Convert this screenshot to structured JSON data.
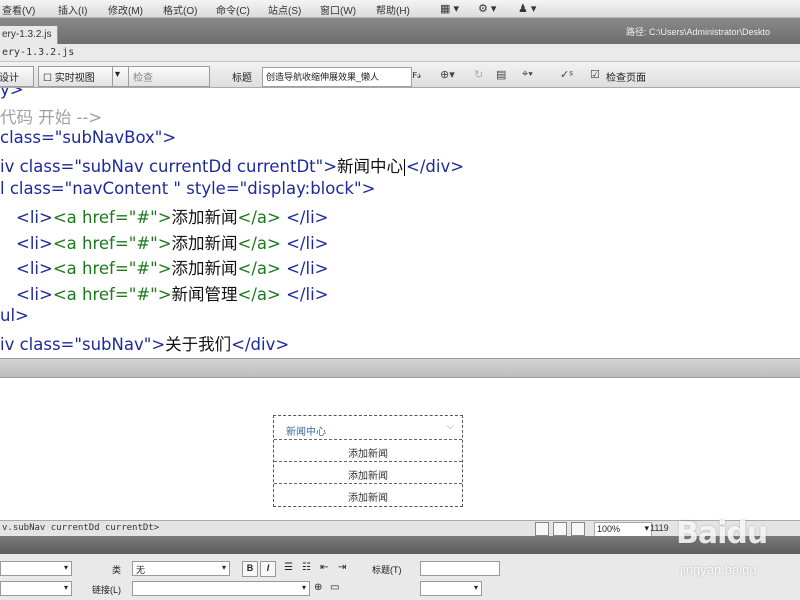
{
  "menu": {
    "items": [
      "查看(V)",
      "插入(I)",
      "修改(M)",
      "格式(O)",
      "命令(C)",
      "站点(S)",
      "窗口(W)",
      "帮助(H)"
    ]
  },
  "titlebar": {
    "tab_label": "ery-1.3.2.js",
    "path_label": "路径: C:\\Users\\Administrator\\Deskto"
  },
  "filebar": {
    "filename": "ery-1.3.2.js"
  },
  "toolbar": {
    "design_label": "设计",
    "live_view_label": "实时视图",
    "inspect_label": "检查",
    "title_label": "标题",
    "title_value": "创造导航收缩伸展效果_懒人",
    "check_page_label": "检查页面"
  },
  "code": {
    "line1": "y>",
    "line2": "代码 开始 -->",
    "line3_attr": "class=",
    "line3_val": "\"subNavBox\"",
    "line3_end": ">",
    "line4_start": "iv class=",
    "line4_val": "\"subNav currentDd currentDt\"",
    "line4_gt": ">",
    "line4_text": "新闻中心",
    "line4_end": "</div>",
    "line5_start": "l class=",
    "line5_val": "\"navContent \"",
    "line5_style": " style=",
    "line5_style_val": "\"display:block\"",
    "line5_end": ">",
    "li_open": "<li>",
    "a_open": "<a href=",
    "a_href": "\"#\"",
    "a_gt": ">",
    "a_close": "</a>",
    "li_close": " </li>",
    "item1": "添加新闻",
    "item2": "添加新闻",
    "item3": "添加新闻",
    "item4": "新闻管理",
    "line10": "ul>",
    "line11_start": "iv class=",
    "line11_val": "\"subNav\"",
    "line11_gt": ">",
    "line11_text": "关于我们",
    "line11_end": "</div>"
  },
  "design": {
    "head_label": "新闻中心",
    "items": [
      "添加新闻",
      "添加新闻",
      "添加新闻"
    ]
  },
  "status": {
    "tag_selector": "v.subNav currentDd currentDt>",
    "zoom": "100%",
    "dims": "1119"
  },
  "properties": {
    "class_label": "类",
    "class_value": "无",
    "bold": "B",
    "italic": "I",
    "title_label": "标题(T)",
    "link_label": "链接(L)"
  },
  "watermark": {
    "brand": "Baidu",
    "sub": "jingyan.baidu"
  }
}
